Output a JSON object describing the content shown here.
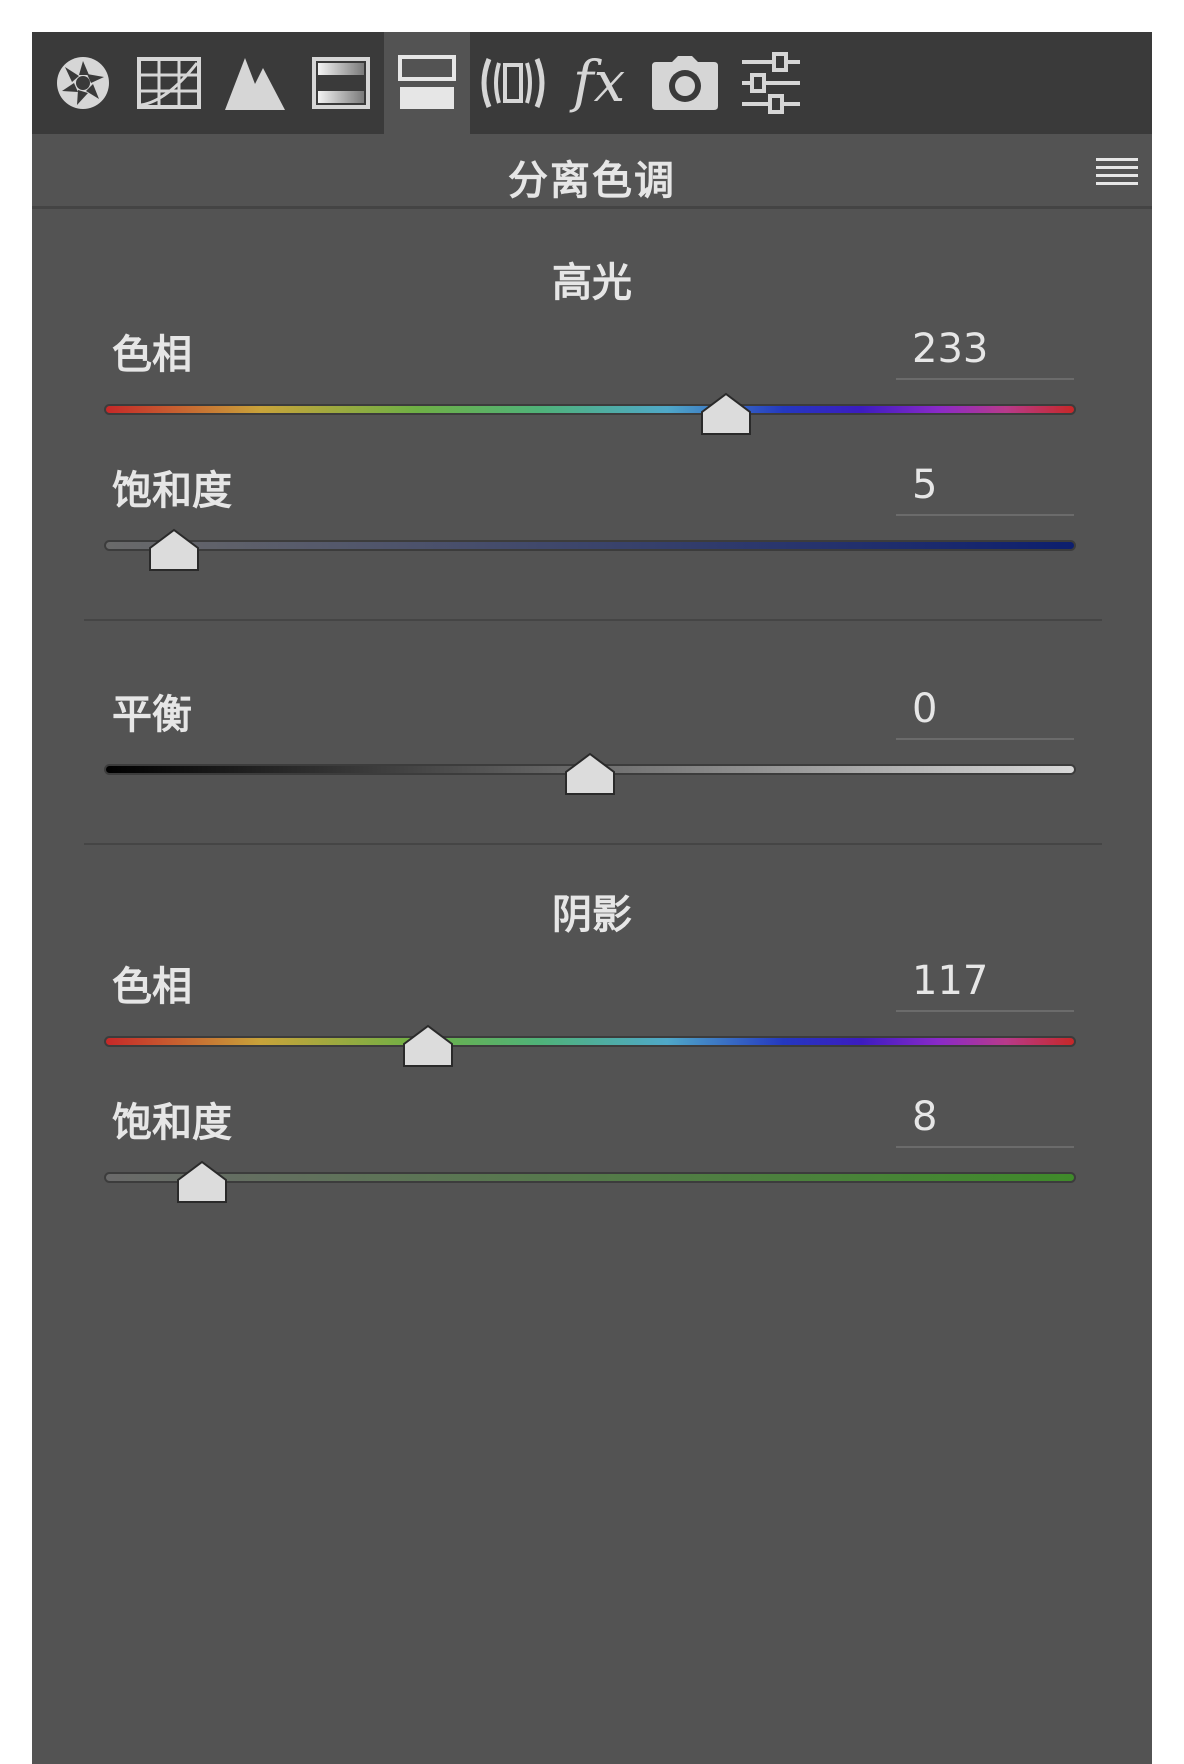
{
  "toolbar": {
    "tools": [
      {
        "name": "aperture-icon",
        "active": false
      },
      {
        "name": "grid-icon",
        "active": false
      },
      {
        "name": "mountain-icon",
        "active": false
      },
      {
        "name": "gradient-icon",
        "active": false
      },
      {
        "name": "split-toning-icon",
        "active": true
      },
      {
        "name": "lens-icon",
        "active": false
      },
      {
        "name": "fx-icon",
        "active": false,
        "text": "fx"
      },
      {
        "name": "camera-icon",
        "active": false
      },
      {
        "name": "sliders-icon",
        "active": false
      }
    ]
  },
  "panel": {
    "title": "分离色调",
    "menu_icon": "hamburger-icon"
  },
  "highlights": {
    "heading": "高光",
    "hue": {
      "label": "色相",
      "value": "233",
      "min": 0,
      "max": 360,
      "track": "hue-spectrum"
    },
    "saturation": {
      "label": "饱和度",
      "value": "5",
      "min": 0,
      "max": 100,
      "track_color_start": "#6a6a6a",
      "track_color_end": "#0d1f6e"
    }
  },
  "balance": {
    "label": "平衡",
    "value": "0",
    "min": -100,
    "max": 100,
    "track_color_start": "#000000",
    "track_color_end": "#d8d8d8"
  },
  "shadows": {
    "heading": "阴影",
    "hue": {
      "label": "色相",
      "value": "117",
      "min": 0,
      "max": 360,
      "track": "hue-spectrum"
    },
    "saturation": {
      "label": "饱和度",
      "value": "8",
      "min": 0,
      "max": 100,
      "track_color_start": "#6a6a6a",
      "track_color_end": "#3f8a2a"
    }
  },
  "colors": {
    "panel_bg": "#535353",
    "toolbar_bg": "#3a3a3a",
    "text": "#e6e6e6",
    "thumb": "#dcdcdc"
  }
}
